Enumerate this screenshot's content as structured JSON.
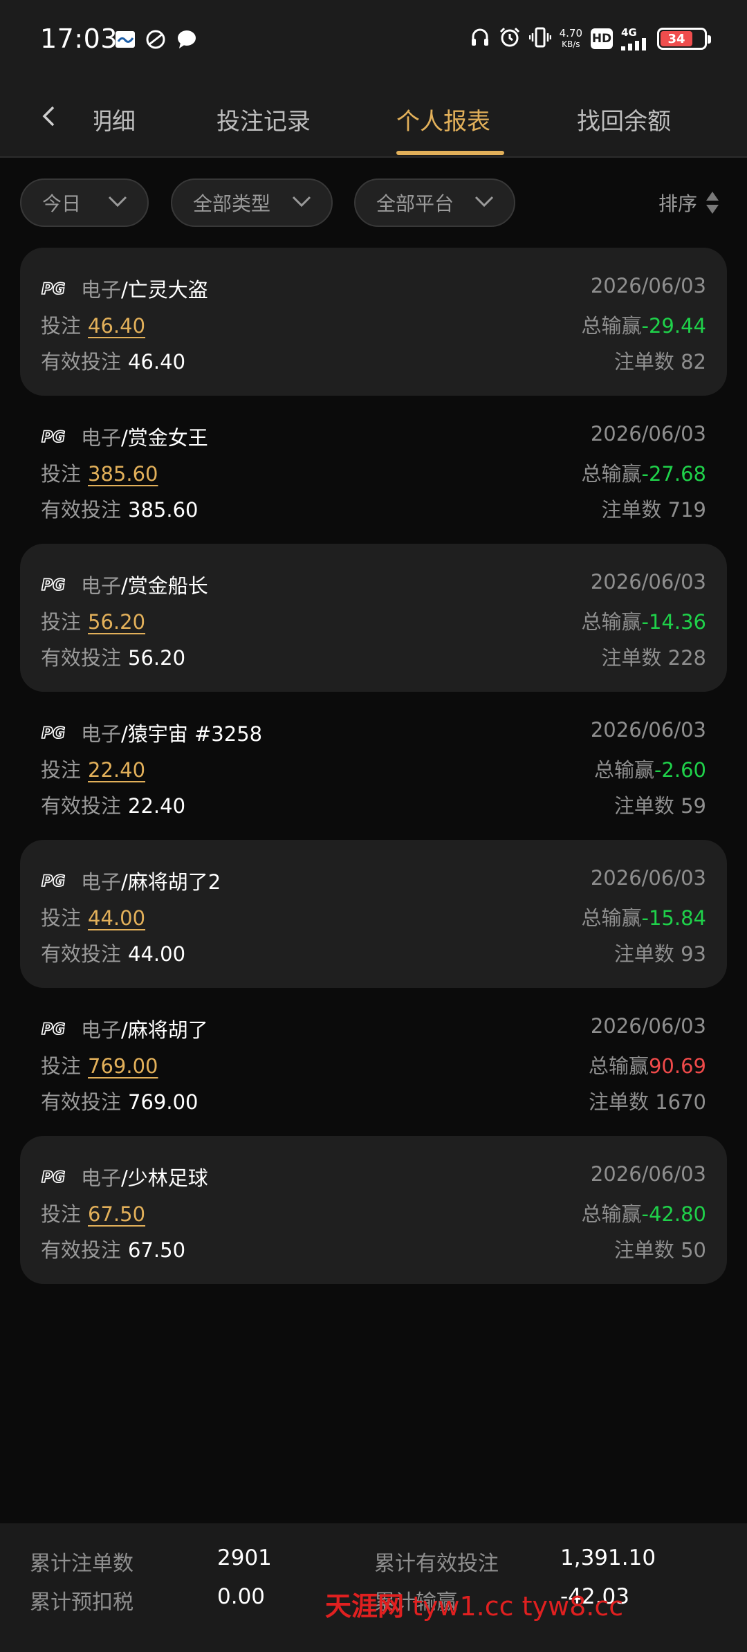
{
  "status_bar": {
    "time": "17:03",
    "net_speed_value": "4.70",
    "net_speed_unit": "KB/s",
    "hd": "HD",
    "network": "4G",
    "battery": "34",
    "icons": [
      "headphones-icon",
      "alarm-icon",
      "vibrate-icon"
    ]
  },
  "nav": {
    "tabs": [
      "明细",
      "投注记录",
      "个人报表",
      "找回余额"
    ],
    "active_tab": "个人报表"
  },
  "filters": {
    "date": "今日",
    "category": "全部类型",
    "platform": "全部平台",
    "sort": "排序"
  },
  "labels": {
    "bet": "投注",
    "valid_bet": "有效投注",
    "total_pnl": "总输赢",
    "order_count": "注单数",
    "provider_logo": "PG"
  },
  "records": [
    {
      "type": "电子",
      "game": "/亡灵大盗",
      "date": "2026/06/03",
      "bet": "46.40",
      "valid_bet": "46.40",
      "pnl": "-29.44",
      "count": "82"
    },
    {
      "type": "电子",
      "game": "/赏金女王",
      "date": "2026/06/03",
      "bet": "385.60",
      "valid_bet": "385.60",
      "pnl": "-27.68",
      "count": "719"
    },
    {
      "type": "电子",
      "game": "/赏金船长",
      "date": "2026/06/03",
      "bet": "56.20",
      "valid_bet": "56.20",
      "pnl": "-14.36",
      "count": "228"
    },
    {
      "type": "电子",
      "game": "/猿宇宙 #3258",
      "date": "2026/06/03",
      "bet": "22.40",
      "valid_bet": "22.40",
      "pnl": "-2.60",
      "count": "59"
    },
    {
      "type": "电子",
      "game": "/麻将胡了2",
      "date": "2026/06/03",
      "bet": "44.00",
      "valid_bet": "44.00",
      "pnl": "-15.84",
      "count": "93"
    },
    {
      "type": "电子",
      "game": "/麻将胡了",
      "date": "2026/06/03",
      "bet": "769.00",
      "valid_bet": "769.00",
      "pnl": "90.69",
      "count": "1670"
    },
    {
      "type": "电子",
      "game": "/少林足球",
      "date": "2026/06/03",
      "bet": "67.50",
      "valid_bet": "67.50",
      "pnl": "-42.80",
      "count": "50"
    }
  ],
  "summary": {
    "total_orders_label": "累计注单数",
    "total_orders": "2901",
    "total_valid_bet_label": "累计有效投注",
    "total_valid_bet": "1,391.10",
    "total_tax_label": "累计预扣税",
    "total_tax": "0.00",
    "total_pnl_label": "累计输赢",
    "total_pnl": "-42.03"
  },
  "watermark": {
    "text_cn": "天涯网",
    "text_url": "tyw1.cc tyw8.cc"
  },
  "colors": {
    "accent": "#e2b05a",
    "loss": "#1fd14a",
    "win": "#f04a4a",
    "background": "#0b0b0b"
  }
}
